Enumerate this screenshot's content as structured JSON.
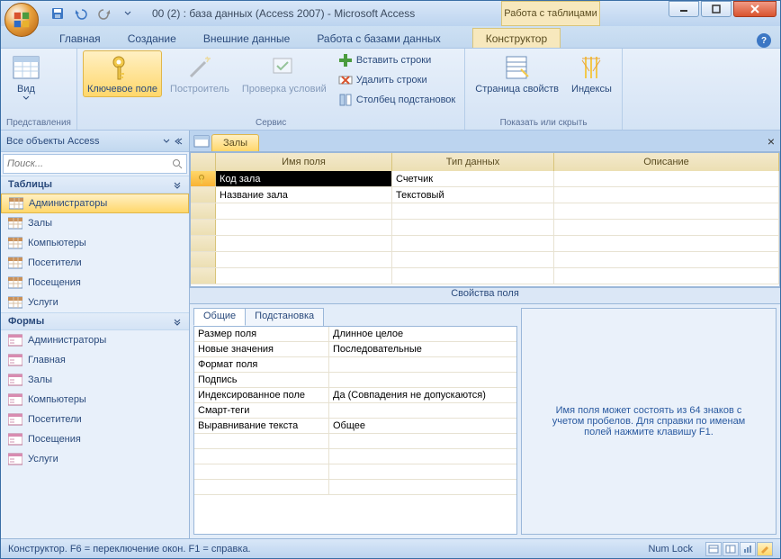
{
  "titlebar": {
    "title": "00 (2) : база данных (Access 2007) - Microsoft Access",
    "context_label": "Работа с таблицами"
  },
  "tabs": {
    "home": "Главная",
    "create": "Создание",
    "external": "Внешние данные",
    "dbtools": "Работа с базами данных",
    "context": "Конструктор"
  },
  "ribbon": {
    "view": "Вид",
    "key_field": "Ключевое поле",
    "builder": "Построитель",
    "validation": "Проверка условий",
    "insert_rows": "Вставить строки",
    "delete_rows": "Удалить строки",
    "lookup_col": "Столбец подстановок",
    "prop_sheet": "Страница свойств",
    "indexes": "Индексы",
    "group_views": "Представления",
    "group_service": "Сервис",
    "group_showhide": "Показать или скрыть"
  },
  "nav": {
    "header": "Все объекты Access",
    "search_placeholder": "Поиск...",
    "group_tables": "Таблицы",
    "group_forms": "Формы",
    "tables": [
      {
        "label": "Администраторы"
      },
      {
        "label": "Залы"
      },
      {
        "label": "Компьютеры"
      },
      {
        "label": "Посетители"
      },
      {
        "label": "Посещения"
      },
      {
        "label": "Услуги"
      }
    ],
    "forms": [
      {
        "label": "Администраторы"
      },
      {
        "label": "Главная"
      },
      {
        "label": "Залы"
      },
      {
        "label": "Компьютеры"
      },
      {
        "label": "Посетители"
      },
      {
        "label": "Посещения"
      },
      {
        "label": "Услуги"
      }
    ]
  },
  "doc": {
    "tab_name": "Залы",
    "col_name": "Имя поля",
    "col_type": "Тип данных",
    "col_desc": "Описание",
    "fields": [
      {
        "name": "Код зала",
        "type": "Счетчик",
        "desc": "",
        "key": true,
        "active": true
      },
      {
        "name": "Название зала",
        "type": "Текстовый",
        "desc": "",
        "key": false,
        "active": false
      }
    ]
  },
  "props": {
    "header": "Свойства поля",
    "tab_general": "Общие",
    "tab_lookup": "Подстановка",
    "rows": [
      {
        "name": "Размер поля",
        "val": "Длинное целое"
      },
      {
        "name": "Новые значения",
        "val": "Последовательные"
      },
      {
        "name": "Формат поля",
        "val": ""
      },
      {
        "name": "Подпись",
        "val": ""
      },
      {
        "name": "Индексированное поле",
        "val": "Да (Совпадения не допускаются)"
      },
      {
        "name": "Смарт-теги",
        "val": ""
      },
      {
        "name": "Выравнивание текста",
        "val": "Общее"
      }
    ],
    "hint": "Имя поля может состоять из 64 знаков с учетом пробелов. Для справки по именам полей нажмите клавишу F1."
  },
  "status": {
    "text": "Конструктор. F6 = переключение окон. F1 = справка.",
    "numlock": "Num Lock"
  }
}
